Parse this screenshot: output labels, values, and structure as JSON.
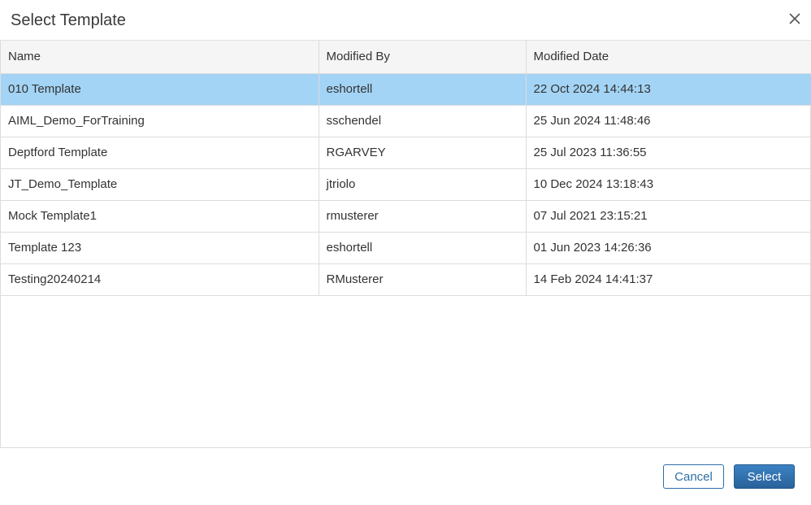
{
  "dialog": {
    "title": "Select Template",
    "close_icon": "close-icon"
  },
  "table": {
    "columns": [
      "Name",
      "Modified By",
      "Modified Date"
    ],
    "rows": [
      {
        "name": "010 Template",
        "modified_by": "eshortell",
        "modified_date": "22 Oct 2024 14:44:13",
        "selected": true
      },
      {
        "name": "AIML_Demo_ForTraining",
        "modified_by": "sschendel",
        "modified_date": "25 Jun 2024 11:48:46",
        "selected": false
      },
      {
        "name": "Deptford Template",
        "modified_by": "RGARVEY",
        "modified_date": "25 Jul 2023 11:36:55",
        "selected": false
      },
      {
        "name": "JT_Demo_Template",
        "modified_by": "jtriolo",
        "modified_date": "10 Dec 2024 13:18:43",
        "selected": false
      },
      {
        "name": "Mock Template1",
        "modified_by": "rmusterer",
        "modified_date": "07 Jul 2021 23:15:21",
        "selected": false
      },
      {
        "name": "Template 123",
        "modified_by": "eshortell",
        "modified_date": "01 Jun 2023 14:26:36",
        "selected": false
      },
      {
        "name": "Testing20240214",
        "modified_by": "RMusterer",
        "modified_date": "14 Feb 2024 14:41:37",
        "selected": false
      }
    ]
  },
  "footer": {
    "cancel_label": "Cancel",
    "select_label": "Select"
  },
  "colors": {
    "selected_row": "#a3d4f5",
    "primary": "#2e6fa7"
  }
}
